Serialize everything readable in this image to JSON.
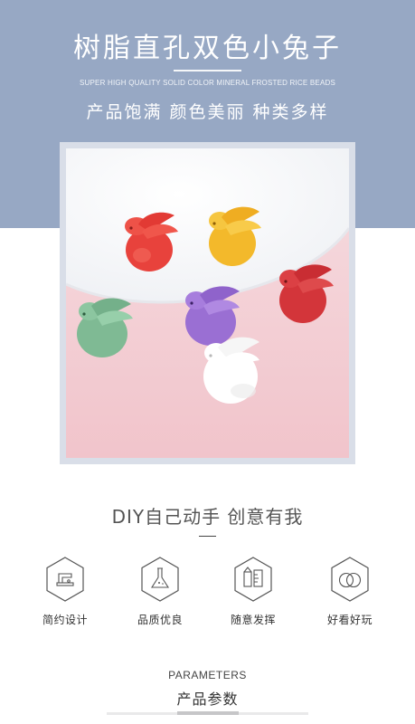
{
  "hero": {
    "title": "树脂直孔双色小兔子",
    "subtitle_en": "SUPER HIGH QUALITY SOLID COLOR MINERAL FROSTED RICE BEADS",
    "tagline": "产品饱满 颜色美丽 种类多样",
    "band_color": "#97a8c4"
  },
  "photo": {
    "content": "product photo of bunny-shaped resin beads",
    "bead_colors": [
      "#e8423c",
      "#f3b92b",
      "#d3353a",
      "#7fba94",
      "#9a6fd3",
      "#ffffff"
    ]
  },
  "diy": {
    "heading": "DIY自己动手 创意有我"
  },
  "features": [
    {
      "icon": "tailor-machine-icon",
      "label": "简约设计"
    },
    {
      "icon": "flask-icon",
      "label": "品质优良"
    },
    {
      "icon": "palette-ruler-icon",
      "label": "随意发挥"
    },
    {
      "icon": "rings-icon",
      "label": "好看好玩"
    }
  ],
  "parameters": {
    "title_en": "PARAMETERS",
    "title_cn": "产品参数"
  }
}
